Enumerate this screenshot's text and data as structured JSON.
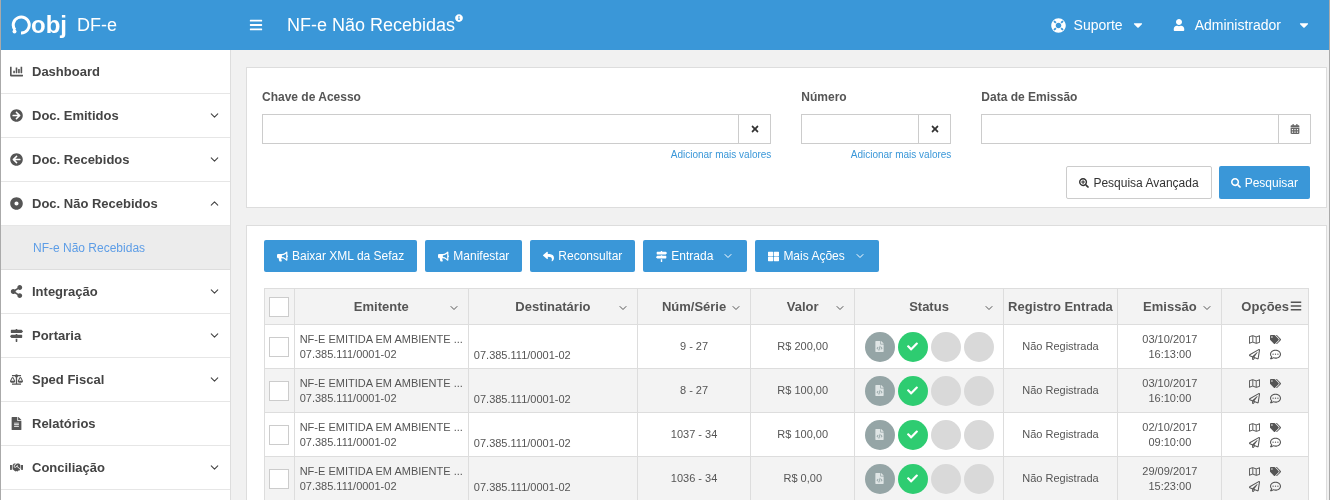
{
  "header": {
    "logo_text": "obj",
    "product": "DF-e",
    "title": "NF-e Não Recebidas",
    "support": "Suporte",
    "user": "Administrador"
  },
  "sidebar": {
    "items": [
      {
        "label": "Dashboard",
        "selected": false
      },
      {
        "label": "Doc. Emitidos",
        "selected": false,
        "expanded": false
      },
      {
        "label": "Doc. Recebidos",
        "selected": false,
        "expanded": false
      },
      {
        "label": "Doc. Não Recebidos",
        "selected": false,
        "expanded": true,
        "children": [
          {
            "label": "NF-e Não Recebidas",
            "selected": true
          }
        ]
      },
      {
        "label": "Integração",
        "selected": false,
        "expanded": false
      },
      {
        "label": "Portaria",
        "selected": false,
        "expanded": false
      },
      {
        "label": "Sped Fiscal",
        "selected": false,
        "expanded": false
      },
      {
        "label": "Relatórios",
        "selected": false
      },
      {
        "label": "Conciliação",
        "selected": false,
        "expanded": false
      }
    ]
  },
  "filters": [
    {
      "label": "Chave de Acesso",
      "kind": "clearable",
      "link": "Adicionar mais valores"
    },
    {
      "label": "Número",
      "kind": "clearable",
      "link": "Adicionar mais valores"
    },
    {
      "label": "Data de Emissão",
      "kind": "date"
    }
  ],
  "search_buttons": [
    {
      "label": "Pesquisa Avançada",
      "kind": "default"
    },
    {
      "label": "Pesquisar",
      "kind": "primary"
    }
  ],
  "actions": [
    {
      "label": "Baixar XML da Sefaz",
      "dropdown": false
    },
    {
      "label": "Manifestar",
      "dropdown": false
    },
    {
      "label": "Reconsultar",
      "dropdown": false
    },
    {
      "label": "Entrada",
      "dropdown": true
    },
    {
      "label": "Mais Ações",
      "dropdown": true
    }
  ],
  "table": {
    "columns": [
      {
        "label": "Emitente",
        "sortable": true
      },
      {
        "label": "Destinatário",
        "sortable": true
      },
      {
        "label": "Núm/Série",
        "sortable": true
      },
      {
        "label": "Valor",
        "sortable": true
      },
      {
        "label": "Status",
        "sortable": true
      },
      {
        "label": "Registro Entrada",
        "sortable": false
      },
      {
        "label": "Emissão",
        "sortable": true
      },
      {
        "label": "Opções",
        "sortable": false
      }
    ],
    "select_all": {
      "checked": false
    },
    "rows": [
      {
        "checked": false,
        "emitente": "NF-E EMITIDA EM AMBIENTE ...",
        "emitente_cnpj": "07.385.111/0001-02",
        "destinatario": "07.385.111/0001-02",
        "num_serie": "9 - 27",
        "valor": "R$ 200,00",
        "status": [
          {
            "kind": "document"
          },
          {
            "kind": "ok"
          },
          {
            "kind": "empty"
          },
          {
            "kind": "empty"
          }
        ],
        "registro": "Não Registrada",
        "date": "03/10/2017",
        "time": "16:13:00"
      },
      {
        "checked": false,
        "emitente": "NF-E EMITIDA EM AMBIENTE ...",
        "emitente_cnpj": "07.385.111/0001-02",
        "destinatario": "07.385.111/0001-02",
        "num_serie": "8 - 27",
        "valor": "R$ 100,00",
        "status": [
          {
            "kind": "document"
          },
          {
            "kind": "ok"
          },
          {
            "kind": "empty"
          },
          {
            "kind": "empty"
          }
        ],
        "registro": "Não Registrada",
        "date": "03/10/2017",
        "time": "16:10:00"
      },
      {
        "checked": false,
        "emitente": "NF-E EMITIDA EM AMBIENTE ...",
        "emitente_cnpj": "07.385.111/0001-02",
        "destinatario": "07.385.111/0001-02",
        "num_serie": "1037 - 34",
        "valor": "R$ 100,00",
        "status": [
          {
            "kind": "document"
          },
          {
            "kind": "ok"
          },
          {
            "kind": "empty"
          },
          {
            "kind": "empty"
          }
        ],
        "registro": "Não Registrada",
        "date": "02/10/2017",
        "time": "09:10:00"
      },
      {
        "checked": false,
        "emitente": "NF-E EMITIDA EM AMBIENTE ...",
        "emitente_cnpj": "07.385.111/0001-02",
        "destinatario": "07.385.111/0001-02",
        "num_serie": "1036 - 34",
        "valor": "R$ 0,00",
        "status": [
          {
            "kind": "document"
          },
          {
            "kind": "ok"
          },
          {
            "kind": "empty"
          },
          {
            "kind": "empty"
          }
        ],
        "registro": "Não Registrada",
        "date": "29/09/2017",
        "time": "15:23:00"
      }
    ]
  }
}
